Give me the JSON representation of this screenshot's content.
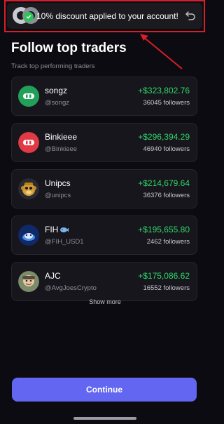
{
  "toast": {
    "message": "10% discount applied to your account!",
    "logo_icon": "app-logo-icon",
    "check_icon": "check-icon",
    "undo_icon": "undo-icon",
    "highlight_color": "#d81e2a"
  },
  "header": {
    "title": "Follow top traders",
    "subtitle": "Track top performing traders"
  },
  "traders": [
    {
      "name": "songz",
      "handle": "@songz",
      "profit": "+$323,802.76",
      "followers": "36045 followers",
      "avatar_icon": "green-logo-avatar"
    },
    {
      "name": "Binkieee",
      "handle": "@Binkieee",
      "profit": "+$296,394.29",
      "followers": "46940 followers",
      "avatar_icon": "red-logo-avatar"
    },
    {
      "name": "Unipcs",
      "handle": "@unipcs",
      "profit": "+$214,679.64",
      "followers": "36376 followers",
      "avatar_icon": "monkey-avatar"
    },
    {
      "name": "FIH",
      "handle": "@FIH_USD1",
      "profit": "+$195,655.80",
      "followers": "2462 followers",
      "avatar_icon": "fish-avatar"
    },
    {
      "name": "AJC",
      "handle": "@AvgJoesCrypto",
      "profit": "+$175,086.62",
      "followers": "16552 followers",
      "avatar_icon": "person-avatar"
    }
  ],
  "show_more_label": "Show more",
  "continue_label": "Continue",
  "colors": {
    "background": "#0c0b11",
    "card": "#17161d",
    "profit_green": "#2fd66a",
    "accent": "#6366f1"
  }
}
